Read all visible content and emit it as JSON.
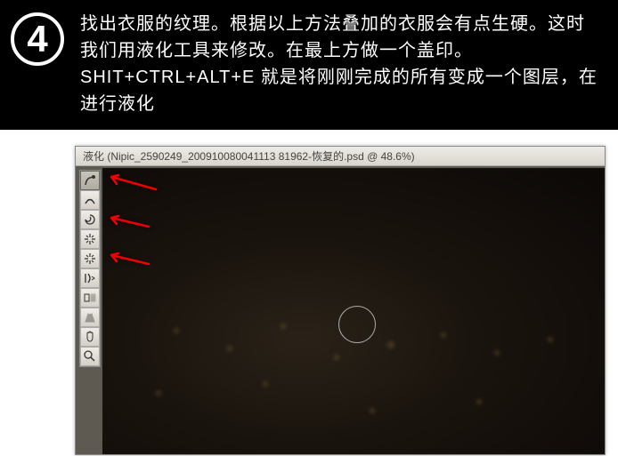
{
  "step": {
    "number": "4"
  },
  "instruction": {
    "text": "找出衣服的纹理。根据以上方法叠加的衣服会有点生硬。这时我们用液化工具来修改。在最上方做一个盖印。SHIT+CTRL+ALT+E 就是将刚刚完成的所有变成一个图层，在进行液化"
  },
  "window": {
    "title": "液化 (Nipic_2590249_200910080041113 81962-恢复的.psd @ 48.6%)"
  },
  "tools": {
    "warp": "forward-warp",
    "reconstruct": "reconstruct",
    "twirl": "twirl-cw",
    "pucker": "pucker",
    "bloat": "bloat",
    "push": "push-left",
    "mirror": "mirror",
    "freeze": "freeze-mask",
    "hand": "hand",
    "zoom": "zoom"
  }
}
